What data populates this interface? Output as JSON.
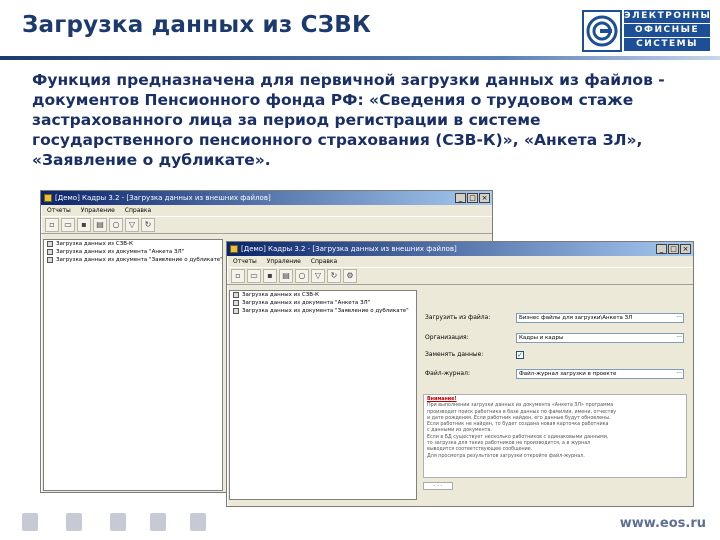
{
  "slide": {
    "title": "Загрузка данных из СЗВК",
    "logo": [
      "ЭЛЕКТРОННЫЕ",
      "ОФИСНЫЕ",
      "СИСТЕМЫ"
    ],
    "description": "Функция предназначена для первичной загрузки данных из файлов - документов Пенсионного фонда РФ: «Сведения о трудовом стаже застрахованного лица за период регистрации в системе государственного пенсионного страхования (СЗВ-К)», «Анкета ЗЛ», «Заявление о дубликате».",
    "footer_url": "www.eos.ru"
  },
  "window_back": {
    "title": "[Демо] Кадры 3.2 - [Загрузка данных из внешних файлов]",
    "menu": [
      "Отчеты",
      "Упраление",
      "Справка"
    ],
    "tree": [
      "Загрузка данных из СЗВ-К",
      "Загрузка данных из документа \"Анкета ЗЛ\"",
      "Загрузка данных из документа \"Заявление о дубликате\""
    ]
  },
  "window_front": {
    "title": "[Демо] Кадры 3.2 - [Загрузка данных из внешних файлов]",
    "menu": [
      "Отчеты",
      "Упраление",
      "Справка"
    ],
    "tree": [
      "Загрузка данных из СЗВ-К",
      "Загрузка данных из документа \"Анкета ЗЛ\"",
      "Загрузка данных из документа \"Заявление о дубликате\""
    ],
    "form": {
      "file_label": "Загрузить из файла:",
      "file_value": "Бизнес файлы для загрузки\\Анкета ЗЛ",
      "org_label": "Организация:",
      "org_value": "Кадры и кадры",
      "update_label": "Заменять данные:",
      "update_checked": "✓",
      "log_label": "Файл-журнал:",
      "log_value": "Файл-журнал загрузки в проекте"
    },
    "notice": {
      "title": "Внимание!",
      "lines": [
        "При выполнении загрузки данных из документа «Анкета ЗЛ» программа",
        "производит поиск работника в базе данных по фамилии, имени, отчеству",
        "и дате рождения. Если работник найден, его данные будут обновлены.",
        "Если работник не найден, то будет создана новая карточка работника",
        "с данными из документа.",
        "Если в БД существует несколько работников с одинаковыми данными,",
        "то загрузка для таких работников не производится, а в журнал",
        "выводится соответствующее сообщение.",
        "Для просмотра результатов загрузки откройте файл-журнал."
      ]
    },
    "status_dots": "· · ·"
  },
  "nav": [
    "nav-home-icon",
    "nav-tree-icon",
    "nav-key-icon",
    "nav-document-icon",
    "nav-list-icon"
  ]
}
